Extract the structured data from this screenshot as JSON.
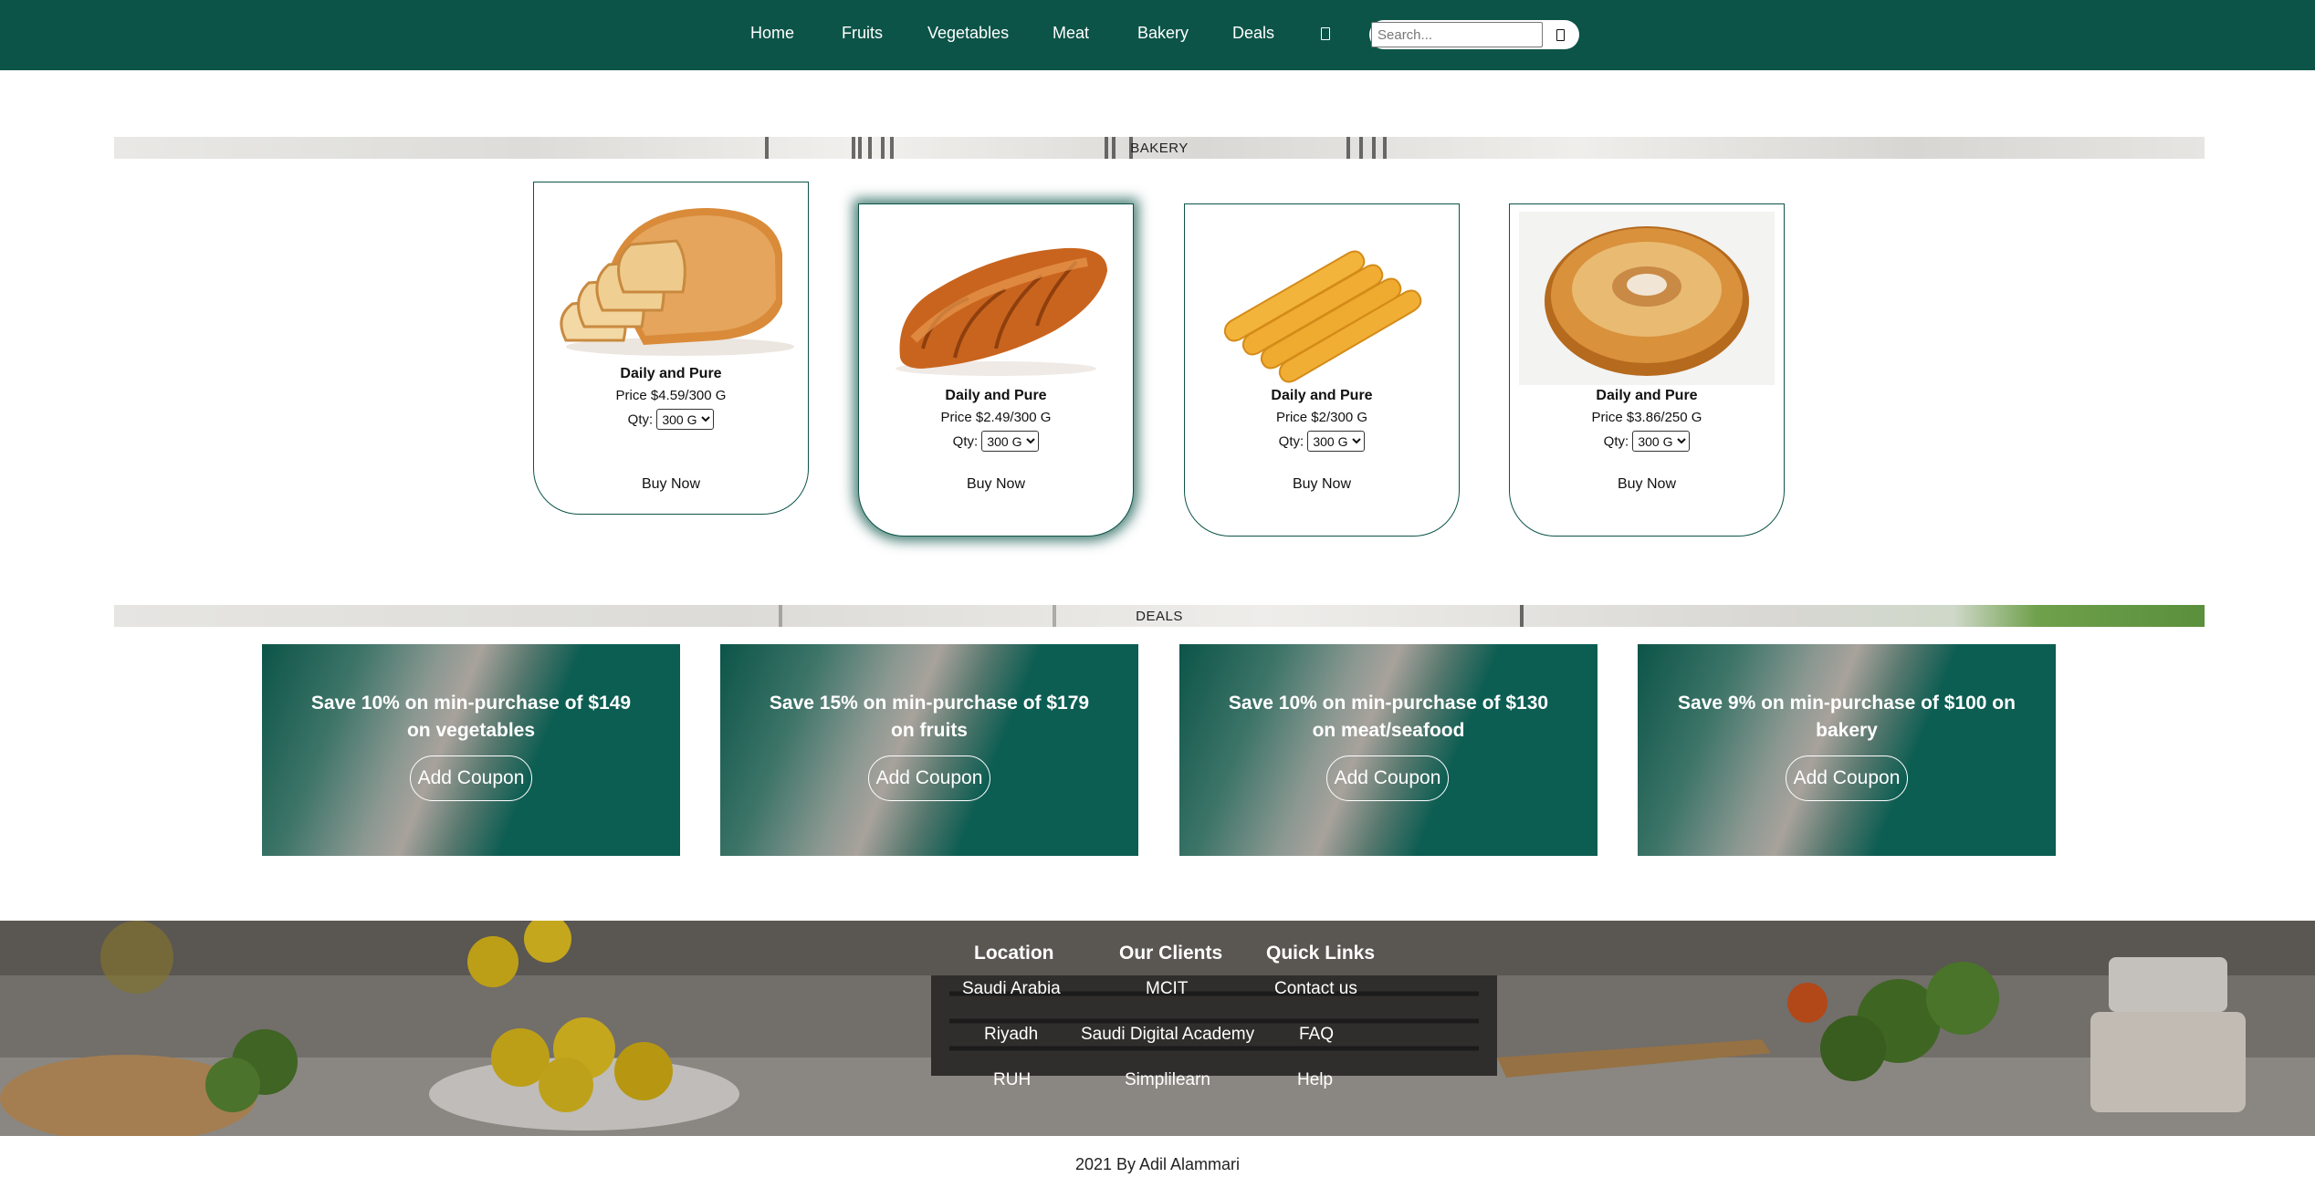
{
  "nav": {
    "links": [
      "Home",
      "Fruits",
      "Vegetables",
      "Meat",
      "Bakery",
      "Deals"
    ],
    "icon": "phone-icon",
    "search_placeholder": "Search...",
    "search_button_icon": "phone-icon"
  },
  "sections": {
    "bakery_title": "BAKERY",
    "deals_title": "DEALS"
  },
  "products": [
    {
      "name": "Daily and Pure",
      "price": "Price $4.59/300 G",
      "qty_label": "Qty:",
      "qty_value": "300 G",
      "buy_label": "Buy Now",
      "image": "sliced-bread"
    },
    {
      "name": "Daily and Pure",
      "price": "Price $2.49/300 G",
      "qty_label": "Qty:",
      "qty_value": "300 G",
      "buy_label": "Buy Now",
      "image": "croissant"
    },
    {
      "name": "Daily and Pure",
      "price": "Price $2/300 G",
      "qty_label": "Qty:",
      "qty_value": "300 G",
      "buy_label": "Buy Now",
      "image": "breadsticks"
    },
    {
      "name": "Daily and Pure",
      "price": "Price $3.86/250 G",
      "qty_label": "Qty:",
      "qty_value": "300 G",
      "buy_label": "Buy Now",
      "image": "bagel"
    }
  ],
  "deals": [
    {
      "text": "Save 10% on min-purchase of $149 on vegetables",
      "button": "Add Coupon"
    },
    {
      "text": "Save 15% on min-purchase of $179 on fruits",
      "button": "Add Coupon"
    },
    {
      "text": "Save 10% on min-purchase of $130 on meat/seafood",
      "button": "Add Coupon"
    },
    {
      "text": "Save 9% on min-purchase of $100 on bakery",
      "button": "Add Coupon"
    }
  ],
  "footer": {
    "columns": [
      {
        "heading": "Location",
        "links": [
          "Saudi Arabia",
          "Riyadh",
          "RUH"
        ]
      },
      {
        "heading": "Our Clients",
        "links": [
          "MCIT",
          "Saudi Digital Academy",
          "Simplilearn"
        ]
      },
      {
        "heading": "Quick Links",
        "links": [
          "Contact us",
          "FAQ",
          "Help"
        ]
      }
    ],
    "copyright": "2021 By Adil Alammari"
  },
  "colors": {
    "brand": "#0c5448",
    "white": "#ffffff"
  }
}
